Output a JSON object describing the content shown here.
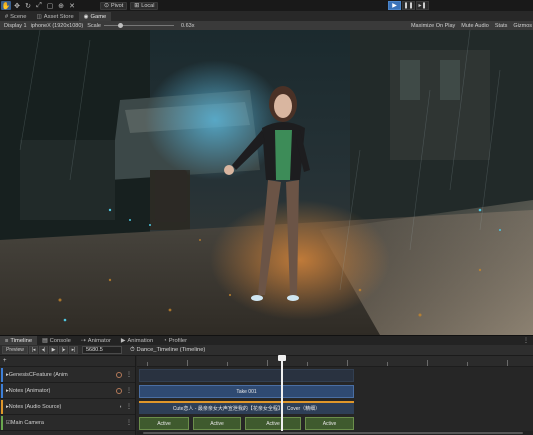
{
  "toolbar": {
    "tools": [
      {
        "icon": "hand-icon",
        "glyph": "✋"
      },
      {
        "icon": "move-icon",
        "glyph": "✥"
      },
      {
        "icon": "rotate-icon",
        "glyph": "↻"
      },
      {
        "icon": "scale-icon",
        "glyph": "⤢"
      },
      {
        "icon": "rect-tool-icon",
        "glyph": "▢"
      },
      {
        "icon": "transform-icon",
        "glyph": "⊕"
      },
      {
        "icon": "custom-tool-icon",
        "glyph": "✕"
      }
    ],
    "pivot_label": "Pivot",
    "local_label": "Local",
    "play_glyph": "▶",
    "pause_glyph": "❚❚",
    "step_glyph": "▸❚"
  },
  "view_tabs": [
    {
      "label": "Scene",
      "icon": "scene-icon",
      "glyph": "#",
      "selected": false
    },
    {
      "label": "Asset Store",
      "icon": "store-icon",
      "glyph": "🛒",
      "selected": false
    },
    {
      "label": "Game",
      "icon": "game-icon",
      "glyph": "◉",
      "selected": true
    }
  ],
  "game_options": {
    "display": "Display 1",
    "resolution": "iphoneX (1920x1080)",
    "scale_label": "Scale",
    "scale_value": "0.63x",
    "maximize": "Maximize On Play",
    "mute": "Mute Audio",
    "stats": "Stats",
    "gizmos": "Gizmos"
  },
  "bottom_tabs": [
    {
      "label": "Timeline",
      "glyph": "≡",
      "selected": true
    },
    {
      "label": "Console",
      "glyph": "▤",
      "selected": false
    },
    {
      "label": "Animator",
      "glyph": "⇢",
      "selected": false
    },
    {
      "label": "Animation",
      "glyph": "▶",
      "selected": false
    },
    {
      "label": "Profiler",
      "glyph": "◔",
      "selected": false
    }
  ],
  "timeline": {
    "preview_label": "Preview",
    "frame_value": "5680.5",
    "asset_name": "Dance_Timeline (Timeline)",
    "add_label": "+",
    "tracks": [
      {
        "name": "▸GenesisCFeature (Anim",
        "color": "#3d7fd8",
        "kind": "anim"
      },
      {
        "name": "▸Notes (Animator)",
        "color": "#3d7fd8",
        "kind": "anim"
      },
      {
        "name": "▸Notes (Audio Source)",
        "color": "#e0972a",
        "kind": "audio"
      },
      {
        "name": "☑Main Camera",
        "color": "#6aa84f",
        "kind": "active"
      }
    ],
    "clips": {
      "anim_label": "Take 001",
      "audio_label": "Cute恋人 - 最亲亲女大声宣泄我的【花亲女全程】",
      "audio_tail": "Cover（精细）",
      "active_label": "Active"
    }
  }
}
